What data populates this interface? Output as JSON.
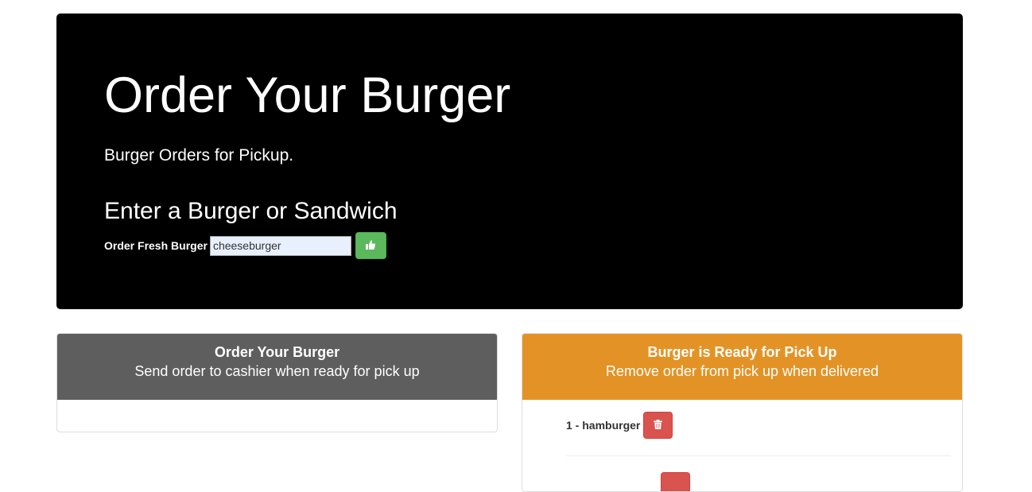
{
  "header": {
    "title": "Order Your Burger",
    "subtitle": "Burger Orders for Pickup."
  },
  "form": {
    "heading": "Enter a Burger or Sandwich",
    "label": "Order Fresh Burger",
    "input_value": "cheeseburger",
    "submit_icon": "thumbs-up-icon",
    "submit_color": "#5cb85c"
  },
  "panels": {
    "order": {
      "title": "Order Your Burger",
      "subtitle": "Send order to cashier when ready for pick up",
      "color": "#5e5e5e",
      "items": []
    },
    "ready": {
      "title": "Burger is Ready for Pick Up",
      "subtitle": "Remove order from pick up when delivered",
      "color": "#e39325",
      "items": [
        {
          "label": "1 - hamburger",
          "action_icon": "trash-icon"
        }
      ]
    }
  },
  "colors": {
    "jumbotron_bg": "#000000",
    "delete_button": "#d9534f"
  }
}
